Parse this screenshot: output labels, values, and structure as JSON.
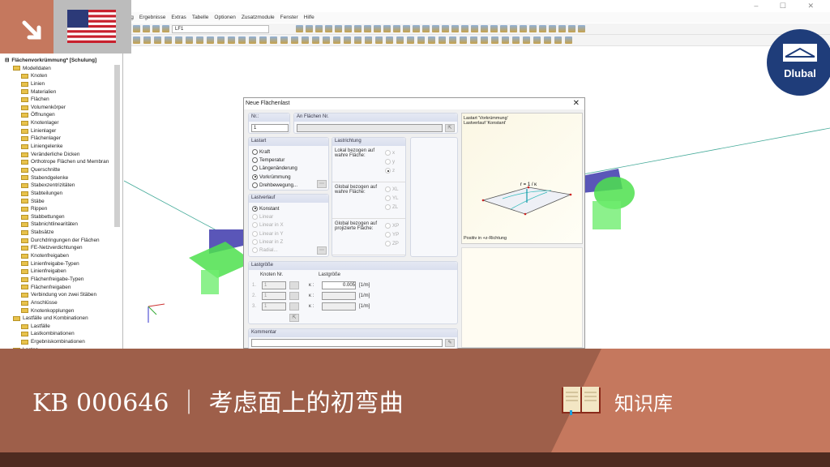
{
  "window": {
    "controls": [
      "–",
      "☐",
      "✕"
    ]
  },
  "menu": [
    "ung",
    "Ergebnisse",
    "Extras",
    "Tabelle",
    "Optionen",
    "Zusatzmodule",
    "Fenster",
    "Hilfe"
  ],
  "toolbar": {
    "loadcase": "LF1"
  },
  "navigator": {
    "root": "Flächenvorkrümmung* [Schulung]",
    "items": [
      {
        "label": "Modelldaten",
        "level": 1
      },
      {
        "label": "Knoten",
        "level": 2
      },
      {
        "label": "Linien",
        "level": 2
      },
      {
        "label": "Materialien",
        "level": 2
      },
      {
        "label": "Flächen",
        "level": 2
      },
      {
        "label": "Volumenkörper",
        "level": 2
      },
      {
        "label": "Öffnungen",
        "level": 2
      },
      {
        "label": "Knotenlager",
        "level": 2
      },
      {
        "label": "Linienlager",
        "level": 2
      },
      {
        "label": "Flächenlager",
        "level": 2
      },
      {
        "label": "Liniengelenke",
        "level": 2
      },
      {
        "label": "Veränderliche Dicken",
        "level": 2
      },
      {
        "label": "Orthotrope Flächen und Membran",
        "level": 2
      },
      {
        "label": "Querschnitte",
        "level": 2
      },
      {
        "label": "Stabendgelenke",
        "level": 2
      },
      {
        "label": "Stabexzentrizitäten",
        "level": 2
      },
      {
        "label": "Stabteilungen",
        "level": 2
      },
      {
        "label": "Stäbe",
        "level": 2
      },
      {
        "label": "Rippen",
        "level": 2
      },
      {
        "label": "Stabbettungen",
        "level": 2
      },
      {
        "label": "Stabnichtlinearitäten",
        "level": 2
      },
      {
        "label": "Stabsätze",
        "level": 2
      },
      {
        "label": "Durchdringungen der Flächen",
        "level": 2
      },
      {
        "label": "FE-Netzverdichtungen",
        "level": 2
      },
      {
        "label": "Knotenfreigaben",
        "level": 2
      },
      {
        "label": "Linienfreigabe-Typen",
        "level": 2
      },
      {
        "label": "Linienfreigaben",
        "level": 2
      },
      {
        "label": "Flächenfreigabe-Typen",
        "level": 2
      },
      {
        "label": "Flächenfreigaben",
        "level": 2
      },
      {
        "label": "Verbindung von zwei Stäben",
        "level": 2
      },
      {
        "label": "Anschlüsse",
        "level": 2
      },
      {
        "label": "Knotenkopplungen",
        "level": 2
      },
      {
        "label": "Lastfälle und Kombinationen",
        "level": 1
      },
      {
        "label": "Lastfälle",
        "level": 2
      },
      {
        "label": "Lastkombinationen",
        "level": 2
      },
      {
        "label": "Ergebniskombinationen",
        "level": 2
      },
      {
        "label": "Lasten",
        "level": 1
      }
    ]
  },
  "dialog": {
    "title": "Neue Flächenlast",
    "nr_label": "Nr.:",
    "nr_value": "1",
    "surfaces_label": "An Flächen Nr.",
    "surfaces_value": "",
    "lastart": {
      "title": "Lastart",
      "options": [
        {
          "label": "Kraft",
          "on": false
        },
        {
          "label": "Temperatur",
          "on": false
        },
        {
          "label": "Längenänderung",
          "on": false
        },
        {
          "label": "Vorkrümmung",
          "on": true
        },
        {
          "label": "Drehbewegung...",
          "on": false
        }
      ]
    },
    "lastverlauf": {
      "title": "Lastverlauf",
      "options": [
        {
          "label": "Konstant",
          "on": true,
          "dis": false
        },
        {
          "label": "Linear",
          "dis": true
        },
        {
          "label": "Linear in X",
          "dis": true
        },
        {
          "label": "Linear in Y",
          "dis": true
        },
        {
          "label": "Linear in Z",
          "dis": true
        },
        {
          "label": "Radial...",
          "dis": true
        }
      ]
    },
    "lastrichtung": {
      "title": "Lastrichtung",
      "groups": [
        {
          "label": "Lokal bezogen auf wahre Fläche:",
          "opts": [
            "x",
            "y",
            "z"
          ]
        },
        {
          "label": "Global bezogen auf wahre Fläche:",
          "opts": [
            "XL",
            "YL",
            "ZL"
          ]
        },
        {
          "label": "Global bezogen auf projizierte Fläche:",
          "opts": [
            "XP",
            "YP",
            "ZP"
          ]
        }
      ]
    },
    "preview": {
      "line1": "Lastart 'Vorkrümmung'",
      "line2": "Lastverlauf 'Konstant'",
      "formula": "r = 1 / κ",
      "footer": "Positiv in +z-Richtung"
    },
    "lastgroesse": {
      "title": "Lastgröße",
      "col_node": "Knoten Nr.",
      "col_value": "Lastgröße",
      "rows": [
        {
          "idx": "1.",
          "node": "1",
          "sym": "κ :",
          "value": "0.005",
          "unit": "[1/m]"
        },
        {
          "idx": "2.",
          "node": "1",
          "sym": "κ :",
          "value": "",
          "unit": "[1/m]"
        },
        {
          "idx": "3.",
          "node": "1",
          "sym": "κ :",
          "value": "",
          "unit": "[1/m]"
        }
      ]
    },
    "kommentar": {
      "title": "Kommentar",
      "value": ""
    }
  },
  "banner": {
    "title": "KB 000646 ｜ 考虑面上的初弯曲",
    "category": "知识库"
  },
  "logo": {
    "text": "Dlubal"
  },
  "colors": {
    "banner_dark": "#9e5f4a",
    "banner_light": "#c5785e",
    "strip": "#4e2b20",
    "logo": "#1f3d7a"
  }
}
